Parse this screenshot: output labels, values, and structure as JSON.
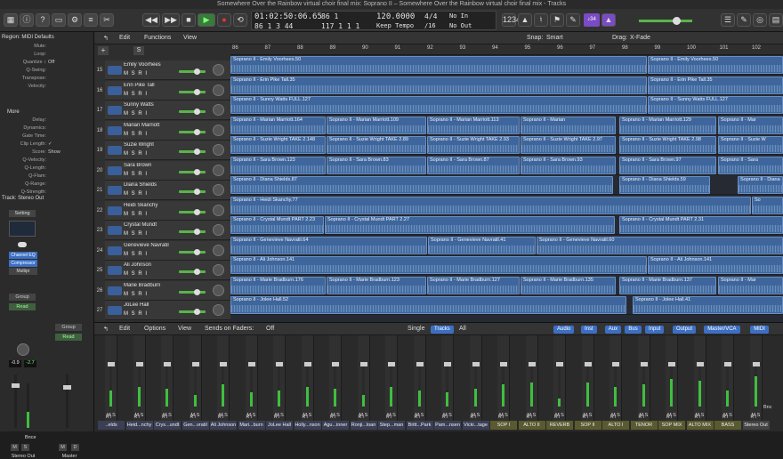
{
  "window": {
    "title": "Somewhere Over the Rainbow virtual choir final mix: Soprano II – Somewhere Over the Rainbow virtual choir final mix - Tracks"
  },
  "lcd": {
    "time": "01:02:50:06.65",
    "bars": "86 1 3 44",
    "tempo": "120.0000",
    "tempo_mode": "Keep Tempo",
    "sig": "4/4",
    "division": "/16",
    "in": "No In",
    "out": "No Out",
    "sub1": "86 1",
    "sub2": "117 1 1 1"
  },
  "toolbar": {
    "counter_badge": "♪34"
  },
  "inspector": {
    "region_header": "Region: MIDI Defaults",
    "rows": [
      {
        "k": "Mute:",
        "v": ""
      },
      {
        "k": "Loop:",
        "v": ""
      },
      {
        "k": "Quantize ↕",
        "v": "Off"
      },
      {
        "k": "Q-Swing:",
        "v": ""
      },
      {
        "k": "Transpose:",
        "v": ""
      },
      {
        "k": "Velocity:",
        "v": ""
      }
    ],
    "more_header": "More",
    "more_rows": [
      {
        "k": "Delay:",
        "v": ""
      },
      {
        "k": "Dynamics:",
        "v": ""
      },
      {
        "k": "Gate Time:",
        "v": ""
      },
      {
        "k": "Clip Length:",
        "v": "✓"
      },
      {
        "k": "Score:",
        "v": "Show"
      },
      {
        "k": "Q-Velocity:",
        "v": ""
      },
      {
        "k": "Q-Length:",
        "v": ""
      },
      {
        "k": "Q-Flam:",
        "v": ""
      },
      {
        "k": "Q-Range:",
        "v": ""
      },
      {
        "k": "Q-Strength:",
        "v": ""
      }
    ],
    "track_header": "Track: Stereo Out",
    "setting": "Setting",
    "plugins": [
      "Channel EQ",
      "Compressor",
      "Multipr"
    ],
    "group": "Group",
    "read": "Read",
    "vol_left": "-0.9",
    "vol_right": "-2.7",
    "bnc": "Bnce",
    "strip_m": "M",
    "strip_s": "S",
    "strip_d": "D",
    "strip_names": [
      "Stereo Out",
      "Master"
    ]
  },
  "tracks_menu": {
    "edit": "Edit",
    "functions": "Functions",
    "view": "View",
    "snap_label": "Snap:",
    "snap": "Smart",
    "drag_label": "Drag:",
    "drag": "X-Fade",
    "add": "+",
    "s": "S"
  },
  "ruler": [
    "86",
    "87",
    "88",
    "89",
    "90",
    "91",
    "92",
    "93",
    "94",
    "95",
    "96",
    "97",
    "98",
    "99",
    "100",
    "101",
    "102"
  ],
  "tracks": [
    {
      "num": "15",
      "name": "Emily Voorhees",
      "regions": [
        {
          "label": "Soprano II - Emily Voorhees.50",
          "s": 0,
          "w": 468
        },
        {
          "label": "Soprano II - Emily Voorhees.50",
          "s": 469,
          "w": 152
        }
      ]
    },
    {
      "num": "16",
      "name": "Erin Pike Tall",
      "regions": [
        {
          "label": "Soprano II - Erin Pike Tall.35",
          "s": 0,
          "w": 468
        },
        {
          "label": "Soprano II - Erin Pike Tall.35",
          "s": 469,
          "w": 152
        }
      ]
    },
    {
      "num": "17",
      "name": "Sunny Watts",
      "regions": [
        {
          "label": "Soprano II - Sunny  Watts FULL.127",
          "s": 0,
          "w": 468
        },
        {
          "label": "Soprano II - Sunny  Watts FULL.127",
          "s": 469,
          "w": 152
        }
      ]
    },
    {
      "num": "18",
      "name": "Marian Marriott",
      "regions": [
        {
          "label": "Soprano II - Marian Marriott.164",
          "s": 0,
          "w": 107
        },
        {
          "label": "Soprano II - Marian Marriott.109",
          "s": 108,
          "w": 112
        },
        {
          "label": "Soprano II - Marian Marriott.113",
          "s": 221,
          "w": 104
        },
        {
          "label": "Soprano II - Marian",
          "s": 326,
          "w": 107
        },
        {
          "label": "Soprano II - Marian Marriott.129",
          "s": 437,
          "w": 109
        },
        {
          "label": "Soprano II - Mar",
          "s": 548,
          "w": 73
        }
      ]
    },
    {
      "num": "19",
      "name": "Suzie Wright",
      "regions": [
        {
          "label": "Soprano II - Suzie Wright TAKE 2.148",
          "s": 0,
          "w": 107
        },
        {
          "label": "Soprano II - Suzie Wright TAKE 2.89",
          "s": 108,
          "w": 112
        },
        {
          "label": "Soprano II - Suzie Wright TAKE 2.93",
          "s": 221,
          "w": 104
        },
        {
          "label": "Soprano II - Suzie Wright TAKE 2.97",
          "s": 326,
          "w": 107
        },
        {
          "label": "Soprano II - Suzie Wright TAKE 2.98",
          "s": 437,
          "w": 109
        },
        {
          "label": "Soprano II - Suzie W",
          "s": 548,
          "w": 73
        }
      ]
    },
    {
      "num": "20",
      "name": "Sara Brown",
      "regions": [
        {
          "label": "Soprano II - Sara Brown.123",
          "s": 0,
          "w": 107
        },
        {
          "label": "Soprano II - Sara Brown.83",
          "s": 108,
          "w": 112
        },
        {
          "label": "Soprano II - Sara Brown.87",
          "s": 221,
          "w": 104
        },
        {
          "label": "Soprano II - Sara Brown.93",
          "s": 326,
          "w": 107
        },
        {
          "label": "Soprano II - Sara Brown.97",
          "s": 437,
          "w": 109
        },
        {
          "label": "Soprano II - Sara",
          "s": 548,
          "w": 73
        }
      ]
    },
    {
      "num": "21",
      "name": "Diana Shields",
      "regions": [
        {
          "label": "Soprano II - Diana Shields.87",
          "s": 0,
          "w": 430
        },
        {
          "label": "Soprano II - Diana Shields.59",
          "s": 437,
          "w": 102
        },
        {
          "label": "Soprano II - Diana",
          "s": 570,
          "w": 51
        }
      ]
    },
    {
      "num": "22",
      "name": "Heidi Skanchy",
      "regions": [
        {
          "label": "Soprano II - Heidi Skanchy.77",
          "s": 0,
          "w": 585
        },
        {
          "label": "So",
          "s": 586,
          "w": 35
        }
      ]
    },
    {
      "num": "23",
      "name": "Crystal Mundt",
      "regions": [
        {
          "label": "Soprano II - Crystal Mundt PART 2.23",
          "s": 0,
          "w": 105
        },
        {
          "label": "Soprano II - Crystal Mundt PART 2.27",
          "s": 106,
          "w": 326
        },
        {
          "label": "Soprano II - Crystal Mundt PART 2.31",
          "s": 437,
          "w": 184
        }
      ]
    },
    {
      "num": "24",
      "name": "Genevieve Navratil",
      "regions": [
        {
          "label": "Soprano II - Genevieve Navratil.64",
          "s": 0,
          "w": 221
        },
        {
          "label": "Soprano II - Genevieve Navratil.41",
          "s": 222,
          "w": 121
        },
        {
          "label": "Soprano II - Genevieve Navratil.60",
          "s": 344,
          "w": 277
        }
      ]
    },
    {
      "num": "25",
      "name": "Ali Johnson",
      "regions": [
        {
          "label": "Soprano II - Ali Johnson.141",
          "s": 0,
          "w": 468
        },
        {
          "label": "Soprano II - Ali Johnson.141",
          "s": 469,
          "w": 152
        }
      ]
    },
    {
      "num": "26",
      "name": "Marie Bradburn",
      "regions": [
        {
          "label": "Soprano II - Marie Bradburn.176",
          "s": 0,
          "w": 107
        },
        {
          "label": "Soprano II - Marie Bradburn.123",
          "s": 108,
          "w": 112
        },
        {
          "label": "Soprano II - Marie Bradburn.127",
          "s": 221,
          "w": 104
        },
        {
          "label": "Soprano II - Marie Bradburn.135",
          "s": 326,
          "w": 107
        },
        {
          "label": "Soprano II - Marie Bradburn.137",
          "s": 437,
          "w": 109
        },
        {
          "label": "Soprano II - Mar",
          "s": 548,
          "w": 73
        }
      ]
    },
    {
      "num": "27",
      "name": "JoLee Hall",
      "regions": [
        {
          "label": "Soprano II - Jolee Hall.52",
          "s": 0,
          "w": 445
        },
        {
          "label": "Soprano II - Jolee Hall.41",
          "s": 452,
          "w": 169
        }
      ]
    }
  ],
  "mixer": {
    "edit": "Edit",
    "options": "Options",
    "view": "View",
    "sends": "Sends on Faders:",
    "sends_val": "Off",
    "modes": [
      "Single",
      "Tracks",
      "All"
    ],
    "filters": [
      "Audio",
      "Inst",
      "Aux",
      "Bus",
      "Input",
      "Output",
      "Master/VCA",
      "MIDI"
    ],
    "strip_names": [
      "..elds",
      "Heid...nchy",
      "Crys...undt",
      "Gen...vratil",
      "Ali Johnson",
      "Mari...burn",
      "JoLee Hall",
      "Holly...nson",
      "Agu...inner",
      "Ronji...loan",
      "Step...man",
      "Britt...Park",
      "Pam...nsen",
      "Vicki...tage",
      "SOP I",
      "ALTO II",
      "REVERB",
      "SOP II",
      "ALTO I",
      "TENOR",
      "SOP MIX",
      "ALTO MIX",
      "BASS",
      "Stereo Out"
    ],
    "levels": [
      0.4,
      0.5,
      0.45,
      0.3,
      0.55,
      0.35,
      0.4,
      0.5,
      0.45,
      0.3,
      0.5,
      0.4,
      0.35,
      0.45,
      0.55,
      0.6,
      0.2,
      0.6,
      0.5,
      0.55,
      0.7,
      0.65,
      0.4,
      0.75
    ],
    "bnc": "Bnc",
    "strip_m": "M",
    "strip_s": "S",
    "strip_ri": "R I"
  }
}
